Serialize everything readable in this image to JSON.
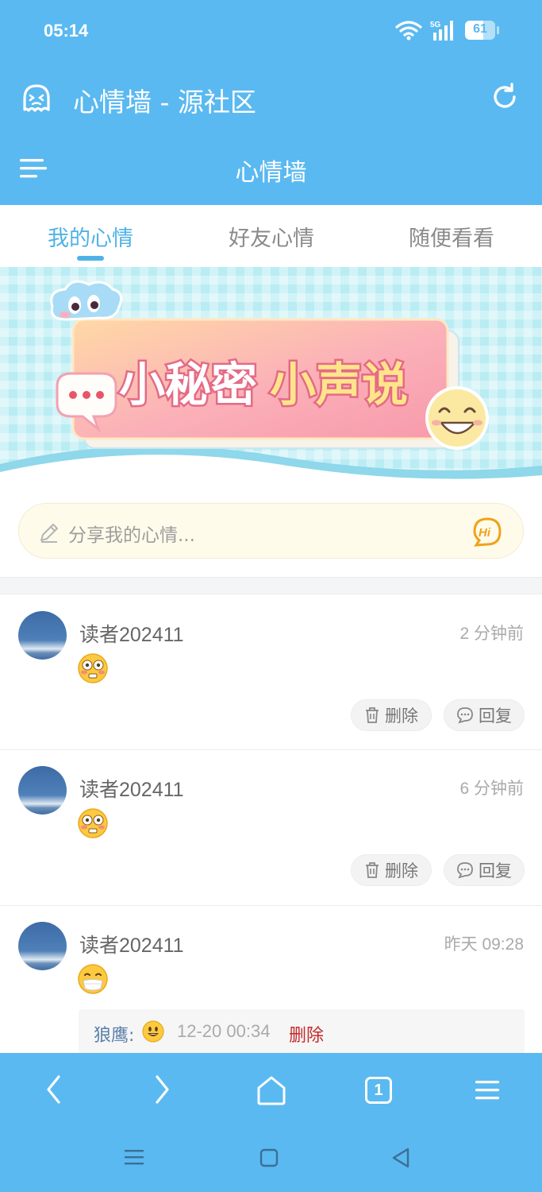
{
  "status_bar": {
    "time": "05:14",
    "network": "5G",
    "battery": "61",
    "battery_level": 0.61
  },
  "app_bar": {
    "title": "心情墙 - 源社区"
  },
  "nav_bar": {
    "title": "心情墙"
  },
  "tabs": [
    {
      "label": "我的心情",
      "active": true
    },
    {
      "label": "好友心情",
      "active": false
    },
    {
      "label": "随便看看",
      "active": false
    }
  ],
  "banner": {
    "text_part1": "小秘密",
    "text_part2": "小声说"
  },
  "composer": {
    "placeholder": "分享我的心情...",
    "hi_badge": "Hi"
  },
  "posts": [
    {
      "user": "读者202411",
      "time": "2 分钟前",
      "emoji": "flushed-face-icon",
      "delete_label": "删除",
      "reply_label": "回复"
    },
    {
      "user": "读者202411",
      "time": "6 分钟前",
      "emoji": "flushed-face-icon",
      "delete_label": "删除",
      "reply_label": "回复"
    },
    {
      "user": "读者202411",
      "time": "昨天 09:28",
      "emoji": "mask-face-icon",
      "reply": {
        "name": "狼鹰:",
        "emoji": "grinning-face-icon",
        "time": "12-20 00:34",
        "delete_label": "删除"
      }
    }
  ],
  "bottom_nav": {
    "tab_count": "1"
  },
  "colors": {
    "primary": "#5ab9f1",
    "tab_active": "#4fb2e6",
    "reply_delete": "#c62828"
  }
}
